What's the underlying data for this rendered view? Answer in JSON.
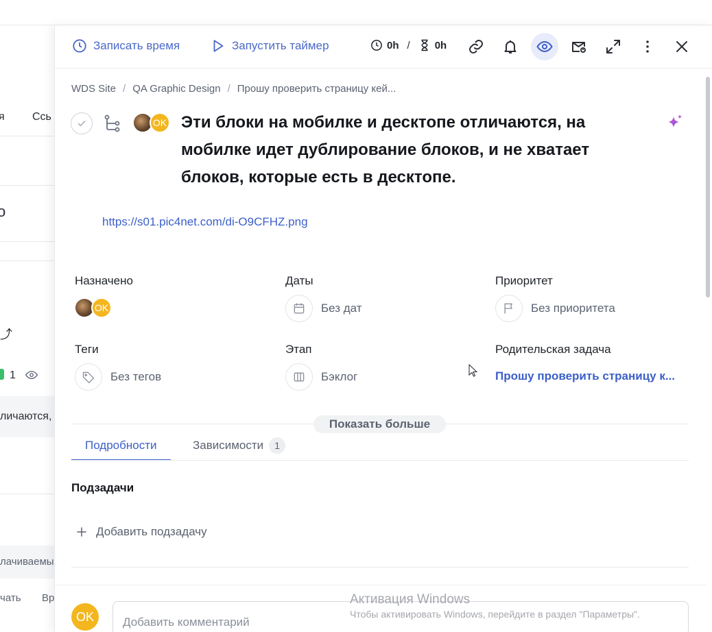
{
  "background_list": {
    "tab_partial": "я",
    "tab_links_partial": "Ссь",
    "row_title_partial": "о",
    "count": "1",
    "row_text_partial": "личаются,",
    "col_partial": "лачиваемы",
    "col_start_partial": "чать",
    "col_time_partial": "Вр"
  },
  "toolbar": {
    "log_time_label": "Записать время",
    "start_timer_label": "Запустить таймер",
    "time_tracked": "0h",
    "time_separator": "/",
    "time_estimate": "0h"
  },
  "breadcrumbs": [
    "WDS Site",
    "QA Graphic Design",
    "Прошу проверить страницу кей..."
  ],
  "task": {
    "title": "Эти блоки на мобилке и десктопе отличаются, на мобилке идет дублирование блоков, и не хватает блоков, которые есть в десктопе.",
    "assignee_initials": "OK",
    "link": "https://s01.pic4net.com/di-O9CFHZ.png"
  },
  "fields": {
    "assigned_label": "Назначено",
    "dates_label": "Даты",
    "dates_value": "Без дат",
    "priority_label": "Приоритет",
    "priority_value": "Без приоритета",
    "tags_label": "Теги",
    "tags_value": "Без тегов",
    "stage_label": "Этап",
    "stage_value": "Бэклог",
    "parent_label": "Родительская задача",
    "parent_value": "Прошу проверить страницу к..."
  },
  "show_more": "Показать больше",
  "tabs": [
    {
      "label": "Подробности",
      "active": true
    },
    {
      "label": "Зависимости",
      "badge": "1",
      "active": false
    }
  ],
  "subtasks": {
    "title": "Подзадачи",
    "add_label": "Добавить подзадачу"
  },
  "comment": {
    "avatar_initials": "OK",
    "placeholder": "Добавить комментарий"
  },
  "watermark": {
    "line1": "Активация Windows",
    "line2": "Чтобы активировать Windows, перейдите в раздел \"Параметры\"."
  },
  "colors": {
    "accent": "#3c5fc8",
    "avatar": "#f3b61f",
    "sparkle": "#a45de6"
  }
}
